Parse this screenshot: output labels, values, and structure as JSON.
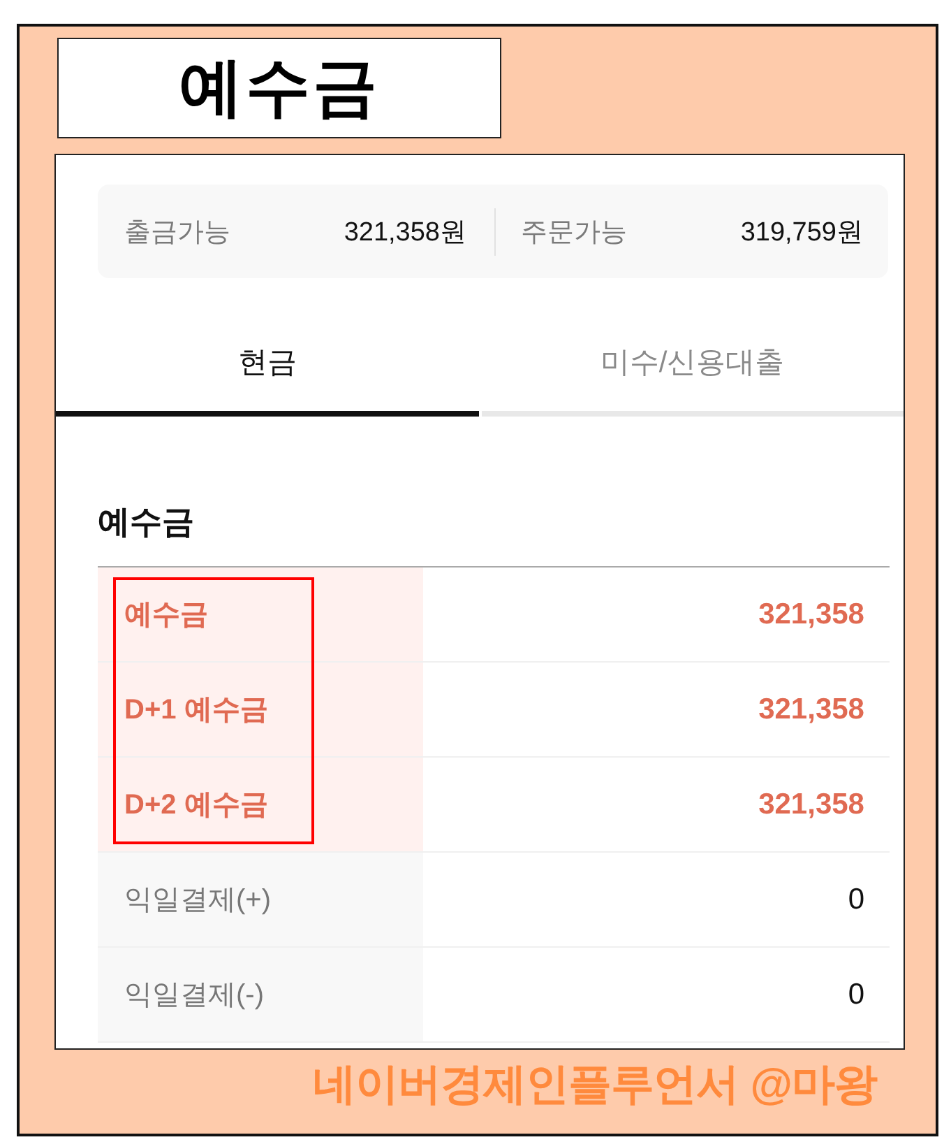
{
  "title": "예수금",
  "summary": [
    {
      "label": "출금가능",
      "value": "321,358원"
    },
    {
      "label": "주문가능",
      "value": "319,759원"
    }
  ],
  "tabs": [
    {
      "label": "현금",
      "selected": true
    },
    {
      "label": "미수/신용대출",
      "selected": false
    }
  ],
  "section": {
    "heading": "예수금",
    "rows": [
      {
        "label": "예수금",
        "value": "321,358",
        "highlighted": true
      },
      {
        "label": "D+1 예수금",
        "value": "321,358",
        "highlighted": true
      },
      {
        "label": "D+2 예수금",
        "value": "321,358",
        "highlighted": true
      },
      {
        "label": "익일결제(+)",
        "value": "0",
        "highlighted": false
      },
      {
        "label": "익일결제(-)",
        "value": "0",
        "highlighted": false
      }
    ]
  },
  "credit": "네이버경제인플루언서 @마왕"
}
